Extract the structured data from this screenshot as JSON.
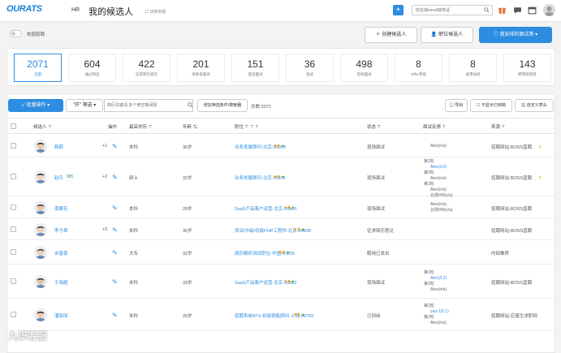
{
  "header": {
    "logo": "OURATS",
    "role": "HR",
    "title": "我的候选人",
    "switch_old": "切换旧版",
    "add": "+",
    "search_placeholder": "姓名或email或电话"
  },
  "filter_toggle_label": "校园招聘",
  "actions": {
    "create": "创建候选人",
    "job_candidate": "职位候选人",
    "my_interview": "我安排的面试等"
  },
  "stats": [
    {
      "num": "2071",
      "label": "全部"
    },
    {
      "num": "604",
      "label": "通过筛选"
    },
    {
      "num": "422",
      "label": "征求简历意见"
    },
    {
      "num": "201",
      "label": "待安排面试"
    },
    {
      "num": "151",
      "label": "电话面试"
    },
    {
      "num": "36",
      "label": "笔试"
    },
    {
      "num": "498",
      "label": "现场面试"
    },
    {
      "num": "8",
      "label": "Offer审批"
    },
    {
      "num": "8",
      "label": "录用协商"
    },
    {
      "num": "143",
      "label": "聘用结接受"
    }
  ],
  "toolbar": {
    "batch": "批量操作",
    "open_filter": "\"开\" 筛选",
    "keyword_placeholder": "简历关键词,多个用空格间隔",
    "add_filter": "增加筛选条件/搜索器",
    "total_label": "总数:2071",
    "export": "导出",
    "no_reapply": "不显示已到岗",
    "custom_header": "自定义表头"
  },
  "columns": {
    "candidate": "候选人",
    "action": "操作",
    "education": "最高学历",
    "age": "年龄",
    "position": "职位",
    "status": "状态",
    "feedback": "面试反馈",
    "source": "来源"
  },
  "rows": [
    {
      "name": "韩熙",
      "tag": "",
      "plus": "+1",
      "edu": "本科",
      "age": "36岁",
      "pos": "业务发展顾问-北京-00003",
      "status": "现场面试",
      "feedback": [
        {
          "t": "Alex(n/a)",
          "c": "g"
        }
      ],
      "source": "招聘网站-BOSS直聘"
    },
    {
      "name": "赵乐",
      "tag": "985",
      "plus": "+2",
      "edu": "硕士",
      "age": "32岁",
      "pos": "业务发展顾问-北京-00811",
      "status": "现场面试",
      "feedback": [
        {
          "t": "第1轮",
          "c": "g"
        },
        {
          "t": "Alex(3.0)",
          "c": "l"
        },
        {
          "t": "第2轮",
          "c": "g"
        },
        {
          "t": "Alex(n/a)",
          "c": "g"
        },
        {
          "t": "第3轮",
          "c": "g"
        },
        {
          "t": "Alex(n/a)",
          "c": "g"
        },
        {
          "t": "云扬HR(n/a)",
          "c": "g"
        }
      ],
      "source": "招聘网站-BOSS直聘"
    },
    {
      "name": "南樱花",
      "tag": "",
      "plus": "",
      "edu": "本科",
      "age": "29岁",
      "pos": "SaaS产品客户运营-北京-00903",
      "status": "现场面试",
      "feedback": [
        {
          "t": "Alex(n/a)",
          "c": "g"
        },
        {
          "t": "云扬HR(n/a)",
          "c": "g"
        }
      ],
      "source": "招聘网站-BOSS直聘"
    },
    {
      "name": "李子昂",
      "tag": "",
      "plus": "+2",
      "edu": "本科",
      "age": "30岁",
      "pos": "资深/中级/初级PHP工程师-北京-00808",
      "status": "征求简历意见",
      "feedback": [],
      "source": "招聘网站-BOSS直聘"
    },
    {
      "name": "余晋豪",
      "tag": "",
      "plus": "",
      "edu": "大专",
      "age": "32岁",
      "pos": "简历解析测试职位-中国-00830",
      "status": "聘用已发出",
      "feedback": [],
      "source": "内部推荐"
    },
    {
      "name": "于海超",
      "tag": "",
      "plus": "",
      "edu": "本科",
      "age": "33岁",
      "pos": "SaaS产品客户运营-北京-00903",
      "status": "现场面试",
      "feedback": [
        {
          "t": "第1轮",
          "c": "g"
        },
        {
          "t": "Alex(3.2)",
          "c": "l"
        },
        {
          "t": "第2轮",
          "c": "g"
        },
        {
          "t": "Alex(n/a)",
          "c": "g"
        }
      ],
      "source": "招聘网站-BOSS直聘"
    },
    {
      "name": "潘丽丽",
      "tag": "",
      "plus": "",
      "edu": "本科",
      "age": "29岁",
      "pos": "招聘系统ATS-初级销售顾问-上海-00793",
      "status": "已到岗",
      "feedback": [
        {
          "t": "第1轮",
          "c": "g"
        },
        {
          "t": "yao-1(3.1)",
          "c": "l"
        },
        {
          "t": "第2轮",
          "c": "g"
        },
        {
          "t": "Alex(n/a)",
          "c": "g"
        }
      ],
      "source": "招聘网站-应届生求职网"
    }
  ],
  "watermark": "九识客服"
}
